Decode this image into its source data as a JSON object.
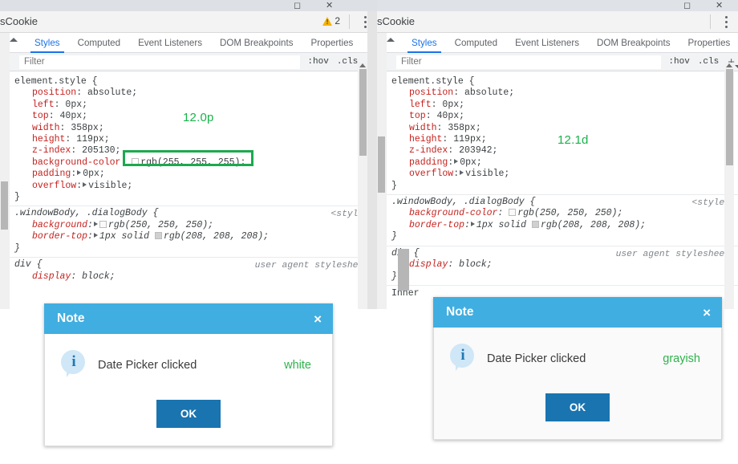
{
  "window": {
    "maximize_icon": "maximize-icon",
    "close_icon": "close-icon"
  },
  "panels": [
    {
      "id": "left",
      "title": "sCookie",
      "warning_count": "2",
      "menu_icon": "kebab-menu-icon",
      "tabs": [
        "Styles",
        "Computed",
        "Event Listeners",
        "DOM Breakpoints",
        "Properties"
      ],
      "tabs_more": "»",
      "active_tab": "Styles",
      "filter_placeholder": "Filter",
      "hov_label": ":hov",
      "cls_label": ".cls",
      "plus_label": "+",
      "annotation": "12.0p",
      "rules": [
        {
          "selector": "element.style {",
          "origin": "",
          "declarations": [
            {
              "prop": "position",
              "value": "absolute;",
              "expandable": false
            },
            {
              "prop": "left",
              "value": "0px;",
              "expandable": false
            },
            {
              "prop": "top",
              "value": "40px;",
              "expandable": false
            },
            {
              "prop": "width",
              "value": "358px;",
              "expandable": false
            },
            {
              "prop": "height",
              "value": "119px;",
              "expandable": false
            },
            {
              "prop": "z-index",
              "value": "205130;",
              "expandable": false
            },
            {
              "prop": "background-color",
              "value": "rgb(255, 255, 255);",
              "expandable": false,
              "swatch": "white",
              "highlighted": true
            },
            {
              "prop": "padding",
              "value": "0px;",
              "expandable": true
            },
            {
              "prop": "overflow",
              "value": "visible;",
              "expandable": true
            }
          ],
          "close": "}"
        },
        {
          "selector": ".windowBody, .dialogBody {",
          "origin": "<style>",
          "italic": true,
          "declarations": [
            {
              "prop": "background",
              "value": "rgb(250, 250, 250);",
              "expandable": true,
              "swatch": "near"
            },
            {
              "prop": "border-top",
              "value": "1px solid rgb(208, 208, 208);",
              "expandable": true,
              "swatch": "gray",
              "swatch_pos": "mid"
            }
          ],
          "close": "}"
        },
        {
          "selector": "div {",
          "origin": "user agent stylesheet",
          "italic": true,
          "declarations": [
            {
              "prop": "display",
              "value": "block;",
              "expandable": false
            }
          ],
          "close": ""
        }
      ]
    },
    {
      "id": "right",
      "title": "sCookie",
      "warning_count": "",
      "menu_icon": "kebab-menu-icon",
      "tabs": [
        "Styles",
        "Computed",
        "Event Listeners",
        "DOM Breakpoints",
        "Properties"
      ],
      "tabs_more": "»",
      "active_tab": "Styles",
      "filter_placeholder": "Filter",
      "hov_label": ":hov",
      "cls_label": ".cls",
      "plus_label": "+",
      "annotation": "12.1d",
      "truncated_section": "Inher",
      "rules": [
        {
          "selector": "element.style {",
          "origin": "",
          "declarations": [
            {
              "prop": "position",
              "value": "absolute;",
              "expandable": false
            },
            {
              "prop": "left",
              "value": "0px;",
              "expandable": false
            },
            {
              "prop": "top",
              "value": "40px;",
              "expandable": false
            },
            {
              "prop": "width",
              "value": "358px;",
              "expandable": false
            },
            {
              "prop": "height",
              "value": "119px;",
              "expandable": false
            },
            {
              "prop": "z-index",
              "value": "203942;",
              "expandable": false
            },
            {
              "prop": "padding",
              "value": "0px;",
              "expandable": true
            },
            {
              "prop": "overflow",
              "value": "visible;",
              "expandable": true
            }
          ],
          "close": "}"
        },
        {
          "selector": ".windowBody, .dialogBody {",
          "origin": "<style>",
          "italic": true,
          "declarations": [
            {
              "prop": "background-color",
              "value": "rgb(250, 250, 250);",
              "expandable": false,
              "swatch": "near"
            },
            {
              "prop": "border-top",
              "value": "1px solid rgb(208, 208, 208);",
              "expandable": true,
              "swatch": "gray",
              "swatch_pos": "mid"
            }
          ],
          "close": "}"
        },
        {
          "selector": "div {",
          "origin": "user agent stylesheet",
          "italic": true,
          "declarations": [
            {
              "prop": "display",
              "value": "block;",
              "expandable": false
            }
          ],
          "close": "}"
        }
      ]
    }
  ],
  "dialogs": [
    {
      "id": "left-dialog",
      "title": "Note",
      "close_label": "×",
      "message": "Date Picker clicked",
      "annotation": "white",
      "button": "OK",
      "body_style": "white"
    },
    {
      "id": "right-dialog",
      "title": "Note",
      "close_label": "×",
      "message": "Date Picker clicked",
      "annotation": "grayish",
      "button": "OK",
      "body_style": "gray"
    }
  ],
  "colors": {
    "accent_blue": "#1a73e8",
    "highlight_green": "#1da94f",
    "annotation_green": "#19b24a",
    "dialog_header_blue": "#40aee0",
    "ok_button_blue": "#1a74b0",
    "property_red": "#c5221f"
  }
}
